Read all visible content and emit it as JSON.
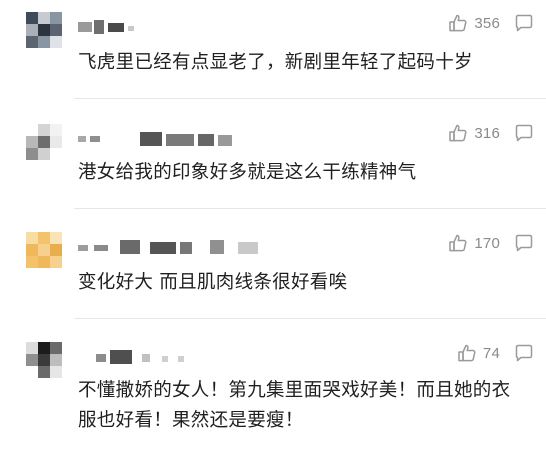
{
  "comments": [
    {
      "likes": "356",
      "text": "飞虎里已经有点显老了，新剧里年轻了起码十岁",
      "avatar_colors": [
        "#3f4a5a",
        "#8a95a3",
        "#c7cbd1",
        "#2d3440",
        "#5b6470",
        "#a9b0b8"
      ]
    },
    {
      "likes": "316",
      "text": "港女给我的印象好多就是这么干练精神气",
      "avatar_colors": [
        "#e9e9e9",
        "#b8b8b8",
        "#6d6d6d",
        "#d4d4d4",
        "#8e8e8e",
        "#f2f2f2"
      ]
    },
    {
      "likes": "170",
      "text": "变化好大 而且肌肉线条很好看唉",
      "avatar_colors": [
        "#f3c26a",
        "#f6d08c",
        "#e8ad4c",
        "#f7dca4",
        "#efb85a",
        "#fae3b6"
      ]
    },
    {
      "likes": "74",
      "text": "不懂撒娇的女人！第九集里面哭戏好美！而且她的衣服也好看！果然还是要瘦！",
      "avatar_colors": [
        "#1c1c1c",
        "#6a6a6a",
        "#bdbdbd",
        "#3a3a3a",
        "#8f8f8f",
        "#dcdcdc"
      ]
    }
  ],
  "icons": {
    "like": "thumbs-up-icon",
    "reply": "comment-bubble-icon"
  },
  "colors": {
    "icon_gray": "#9a9a9a",
    "count_gray": "#8a8a8a",
    "text": "#1f1f1f",
    "divider": "#e6e6e6"
  }
}
